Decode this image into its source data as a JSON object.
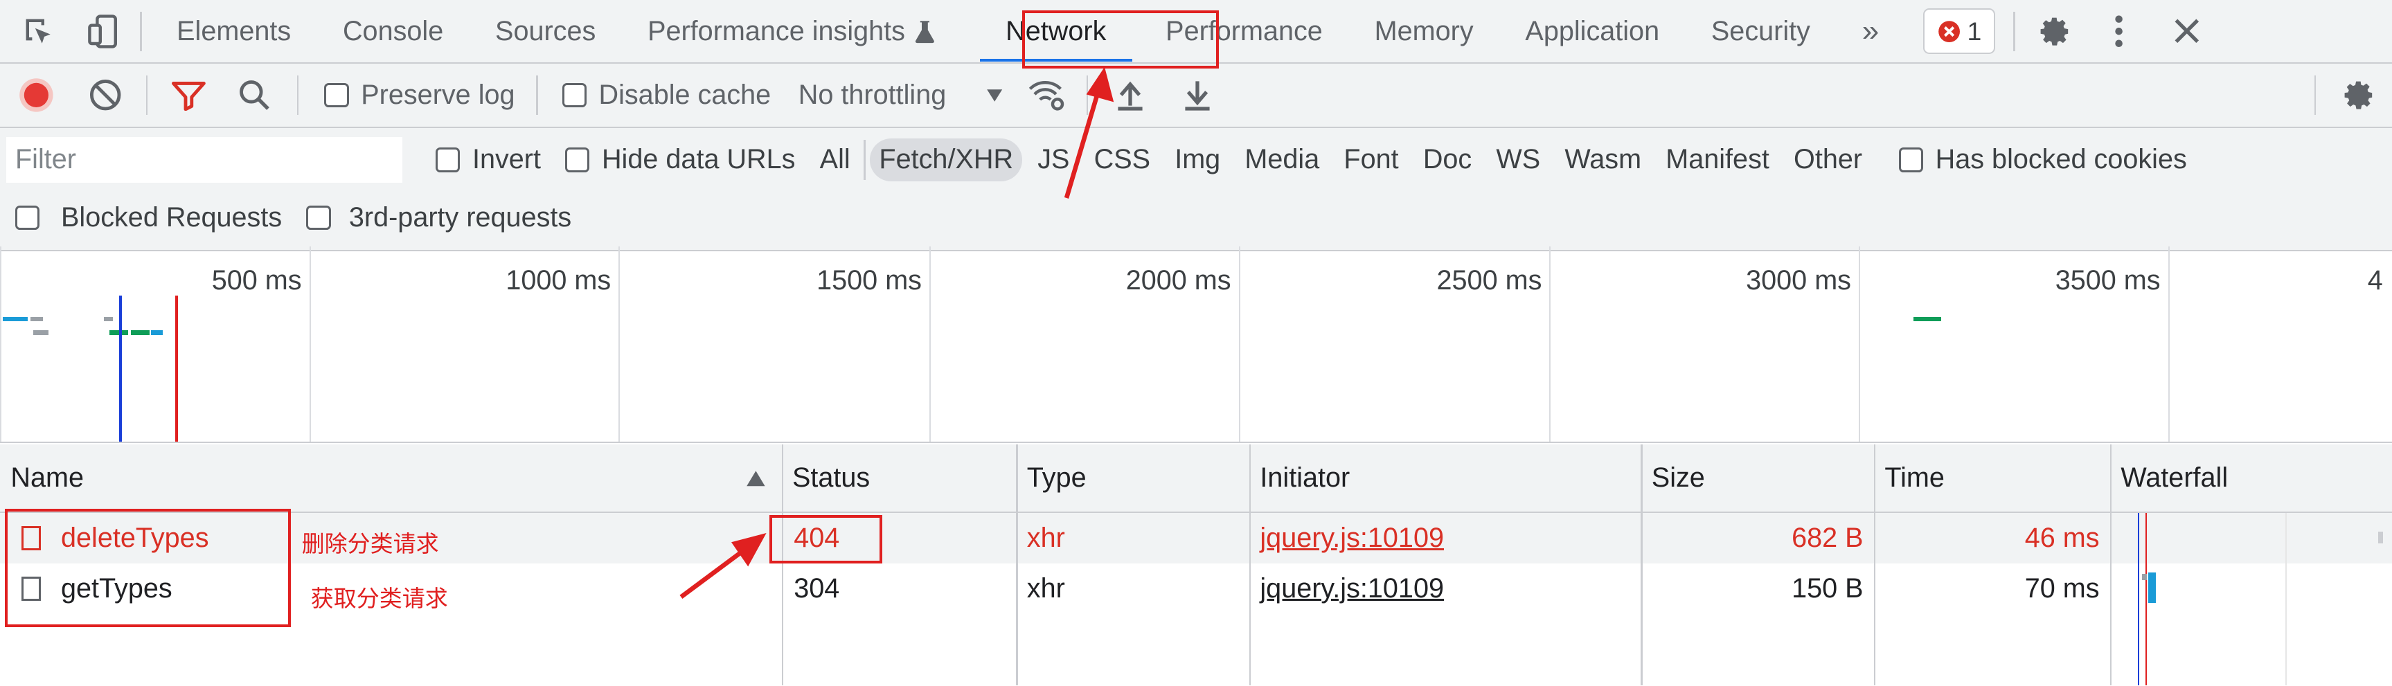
{
  "tabs": {
    "elements": "Elements",
    "console": "Console",
    "sources": "Sources",
    "performance_insights": "Performance insights",
    "network": "Network",
    "performance": "Performance",
    "memory": "Memory",
    "application": "Application",
    "security": "Security",
    "error_count": "1"
  },
  "toolbar": {
    "preserve_log": "Preserve log",
    "disable_cache": "Disable cache",
    "throttling": "No throttling"
  },
  "filter": {
    "placeholder": "Filter",
    "invert": "Invert",
    "hide_data_urls": "Hide data URLs",
    "types": [
      "All",
      "Fetch/XHR",
      "JS",
      "CSS",
      "Img",
      "Media",
      "Font",
      "Doc",
      "WS",
      "Wasm",
      "Manifest",
      "Other"
    ],
    "selected_type": "Fetch/XHR",
    "has_blocked_cookies": "Has blocked cookies",
    "blocked_requests": "Blocked Requests",
    "third_party": "3rd-party requests"
  },
  "overview": {
    "ticks": [
      "500 ms",
      "1000 ms",
      "1500 ms",
      "2000 ms",
      "2500 ms",
      "3000 ms",
      "3500 ms",
      "4"
    ]
  },
  "table": {
    "columns": [
      "Name",
      "Status",
      "Type",
      "Initiator",
      "Size",
      "Time",
      "Waterfall"
    ],
    "rows": [
      {
        "name": "deleteTypes",
        "status": "404",
        "type": "xhr",
        "initiator": "jquery.js:10109",
        "size": "682 B",
        "time": "46 ms",
        "error": true
      },
      {
        "name": "getTypes",
        "status": "304",
        "type": "xhr",
        "initiator": "jquery.js:10109",
        "size": "150 B",
        "time": "70 ms",
        "error": false
      }
    ]
  },
  "annotations": {
    "delete_label": "删除分类请求",
    "get_label": "获取分类请求"
  },
  "colors": {
    "accent": "#1a73e8",
    "error": "#d93025",
    "annotation": "#e02020",
    "record": "#e53935"
  }
}
